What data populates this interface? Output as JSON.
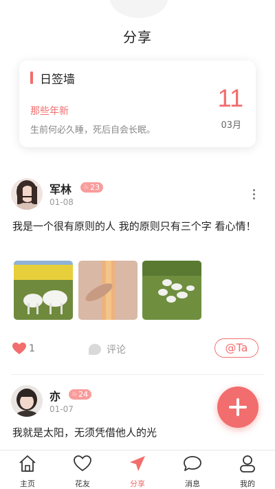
{
  "header": {
    "title": "分享"
  },
  "sign_wall": {
    "title": "日签墙",
    "quote_title": "那些年新",
    "quote_text": "生前何必久睡，死后自会长眠。",
    "day": "11",
    "month": "03月"
  },
  "posts": [
    {
      "username": "军林",
      "badge": "23",
      "date": "01-08",
      "text": "我是一个很有原则的人 我的原则只有三个字 看心情！",
      "likes": "1",
      "comment_label": "评论",
      "at_label": "@Ta"
    },
    {
      "username": "亦",
      "badge": "24",
      "date": "01-07",
      "text": "我就是太阳，无须凭借他人的光"
    }
  ],
  "tabbar": {
    "items": [
      {
        "label": "主页",
        "icon": "home-icon"
      },
      {
        "label": "花友",
        "icon": "heart-icon"
      },
      {
        "label": "分享",
        "icon": "send-icon",
        "active": true
      },
      {
        "label": "消息",
        "icon": "chat-icon"
      },
      {
        "label": "我的",
        "icon": "user-icon"
      }
    ]
  },
  "colors": {
    "accent": "#f26d6d",
    "badge": "#f99c9c"
  }
}
